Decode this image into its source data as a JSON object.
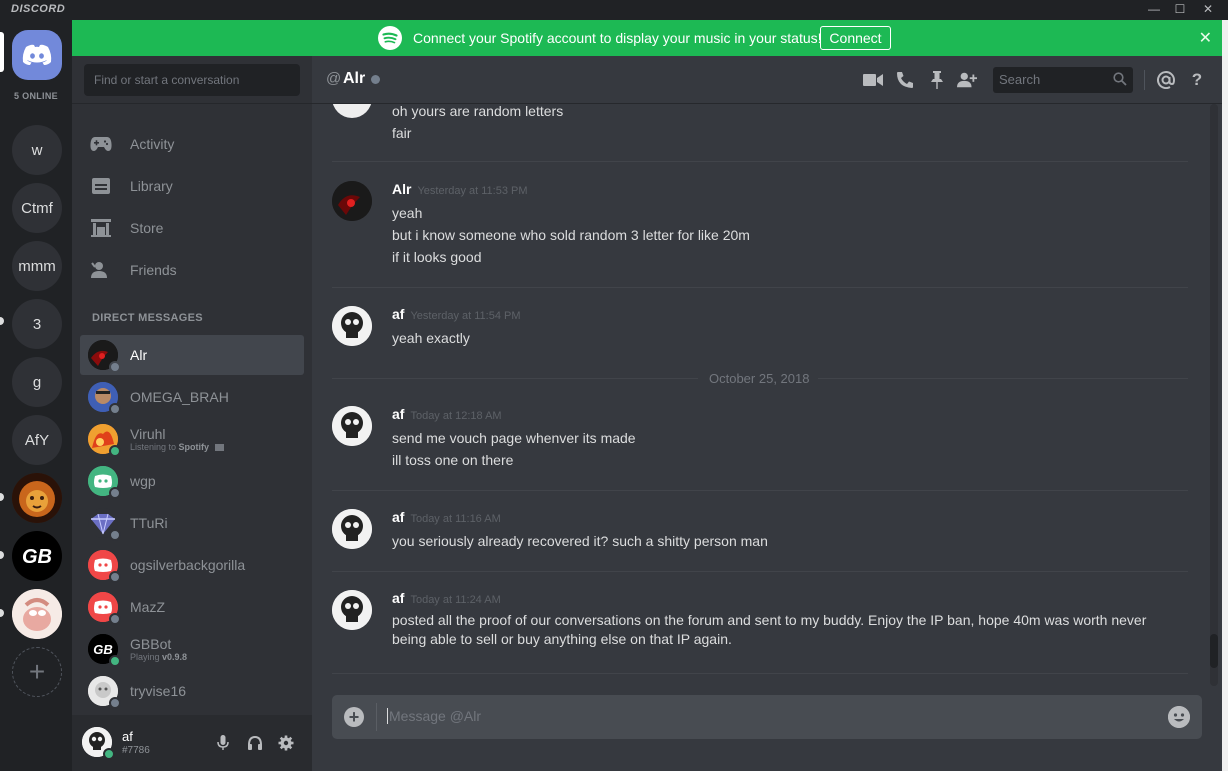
{
  "app": {
    "wordmark": "DISCORD"
  },
  "window_controls": {
    "minimize": "—",
    "maximize": "☐",
    "close": "✕"
  },
  "rail": {
    "online_label": "5 ONLINE",
    "servers": [
      "w",
      "Ctmf",
      "mmm",
      "3",
      "g",
      "AfY"
    ],
    "add": "+"
  },
  "banner": {
    "text": "Connect your Spotify account to display your music in your status!",
    "button": "Connect",
    "close": "✕",
    "color": "#1db954"
  },
  "sidebar": {
    "search_placeholder": "Find or start a conversation",
    "nav": [
      {
        "label": "Activity",
        "icon": "gamepad-icon"
      },
      {
        "label": "Library",
        "icon": "library-icon"
      },
      {
        "label": "Store",
        "icon": "store-icon"
      },
      {
        "label": "Friends",
        "icon": "friends-icon"
      }
    ],
    "dm_header": "DIRECT MESSAGES",
    "dms": [
      {
        "name": "Alr",
        "sub": "",
        "online": false
      },
      {
        "name": "OMEGA_BRAH",
        "sub": "",
        "online": false
      },
      {
        "name": "Viruhl",
        "sub_prefix": "Listening to ",
        "sub_bold": "Spotify",
        "online": true
      },
      {
        "name": "wgp",
        "sub": "",
        "online": false
      },
      {
        "name": "TTuRi",
        "sub": "",
        "online": false
      },
      {
        "name": "ogsilverbackgorilla",
        "sub": "",
        "online": false
      },
      {
        "name": "MazZ",
        "sub": "",
        "online": false
      },
      {
        "name": "GBBot",
        "sub_prefix": "Playing ",
        "sub_bold": "v0.9.8",
        "online": true
      },
      {
        "name": "tryvise16",
        "sub": "",
        "online": false
      }
    ]
  },
  "userbar": {
    "name": "af",
    "tag": "#7786"
  },
  "chat": {
    "at": "@",
    "title": "Alr",
    "search_placeholder": "Search",
    "composer_placeholder": "Message @Alr",
    "date_divider": "October 25, 2018",
    "top_lines": [
      "oh yours are random letters",
      "fair"
    ],
    "groups": [
      {
        "author": "Alr",
        "time": "Yesterday at 11:53 PM",
        "lines": [
          "yeah",
          "but i know someone who sold random 3 letter for like 20m",
          "if it looks good"
        ]
      },
      {
        "author": "af",
        "time": "Yesterday at 11:54 PM",
        "lines": [
          "yeah exactly"
        ]
      },
      {
        "author": "af",
        "time": "Today at 12:18 AM",
        "lines": [
          "send me vouch page whenver its made",
          "ill toss one on there"
        ]
      },
      {
        "author": "af",
        "time": "Today at 11:16 AM",
        "lines": [
          "you seriously already recovered it? such a shitty person man"
        ]
      },
      {
        "author": "af",
        "time": "Today at 11:24 AM",
        "lines": [
          "posted all the proof of our conversations on the forum and sent to my buddy. Enjoy the IP ban, hope 40m was worth never",
          "being able to sell or buy anything else on that IP again."
        ]
      }
    ]
  }
}
